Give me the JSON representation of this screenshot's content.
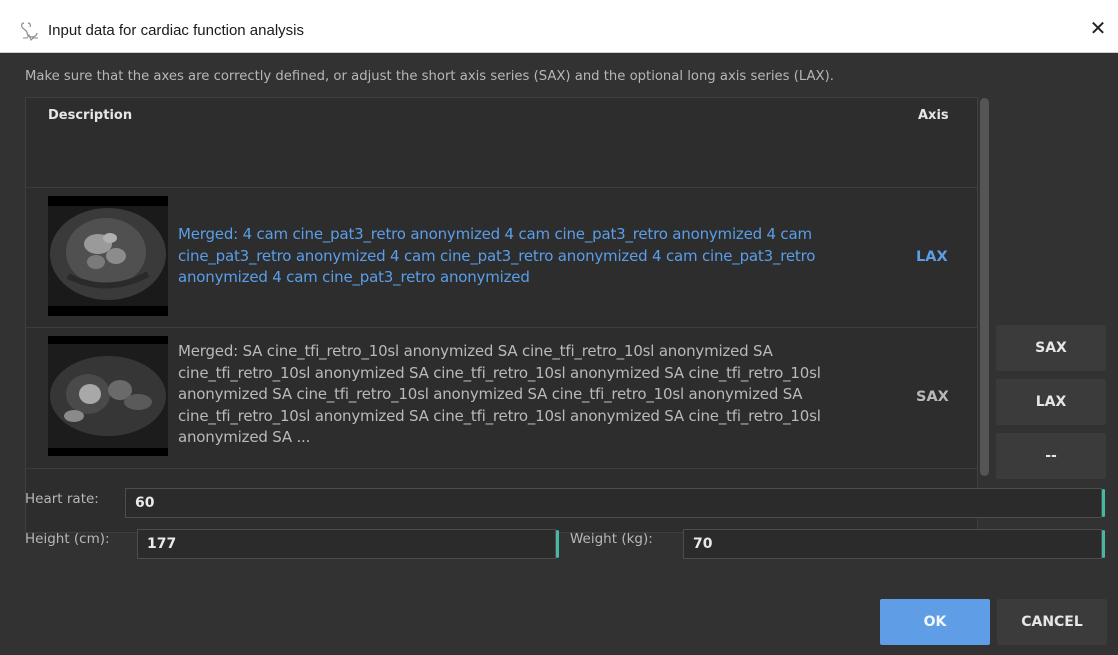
{
  "window": {
    "title": "Input data for cardiac function analysis",
    "close_glyph": "✕",
    "icon": "heart-app-icon"
  },
  "hint": "Make sure that the axes are correctly defined, or adjust the short axis series (SAX) and the optional long axis series (LAX).",
  "table": {
    "columns": {
      "description": "Description",
      "axis": "Axis"
    },
    "rows": [
      {
        "description": "Merged: 4 cam cine_pat3_retro anonymized 4 cam cine_pat3_retro anonymized 4 cam cine_pat3_retro anonymized 4 cam cine_pat3_retro anonymized 4 cam cine_pat3_retro anonymized 4 cam cine_pat3_retro anonymized",
        "axis": "LAX",
        "selected": true
      },
      {
        "description": "Merged: SA cine_tfi_retro_10sl anonymized SA cine_tfi_retro_10sl anonymized SA cine_tfi_retro_10sl anonymized SA cine_tfi_retro_10sl anonymized SA cine_tfi_retro_10sl anonymized SA cine_tfi_retro_10sl anonymized SA cine_tfi_retro_10sl anonymized SA cine_tfi_retro_10sl anonymized SA cine_tfi_retro_10sl anonymized SA cine_tfi_retro_10sl anonymized SA ...",
        "axis": "SAX",
        "selected": false
      }
    ]
  },
  "axis_buttons": {
    "sax": "SAX",
    "lax": "LAX",
    "none": "--"
  },
  "fields": {
    "heart_rate": {
      "label": "Heart rate:",
      "value": "60"
    },
    "height": {
      "label": "Height (cm):",
      "value": "177"
    },
    "weight": {
      "label": "Weight (kg):",
      "value": "70"
    }
  },
  "buttons": {
    "ok": "OK",
    "cancel": "CANCEL"
  },
  "colors": {
    "accent_blue": "#5f9ee6",
    "selected_text": "#5a9ee9",
    "field_accent": "#45b9a3",
    "background": "#323232"
  }
}
